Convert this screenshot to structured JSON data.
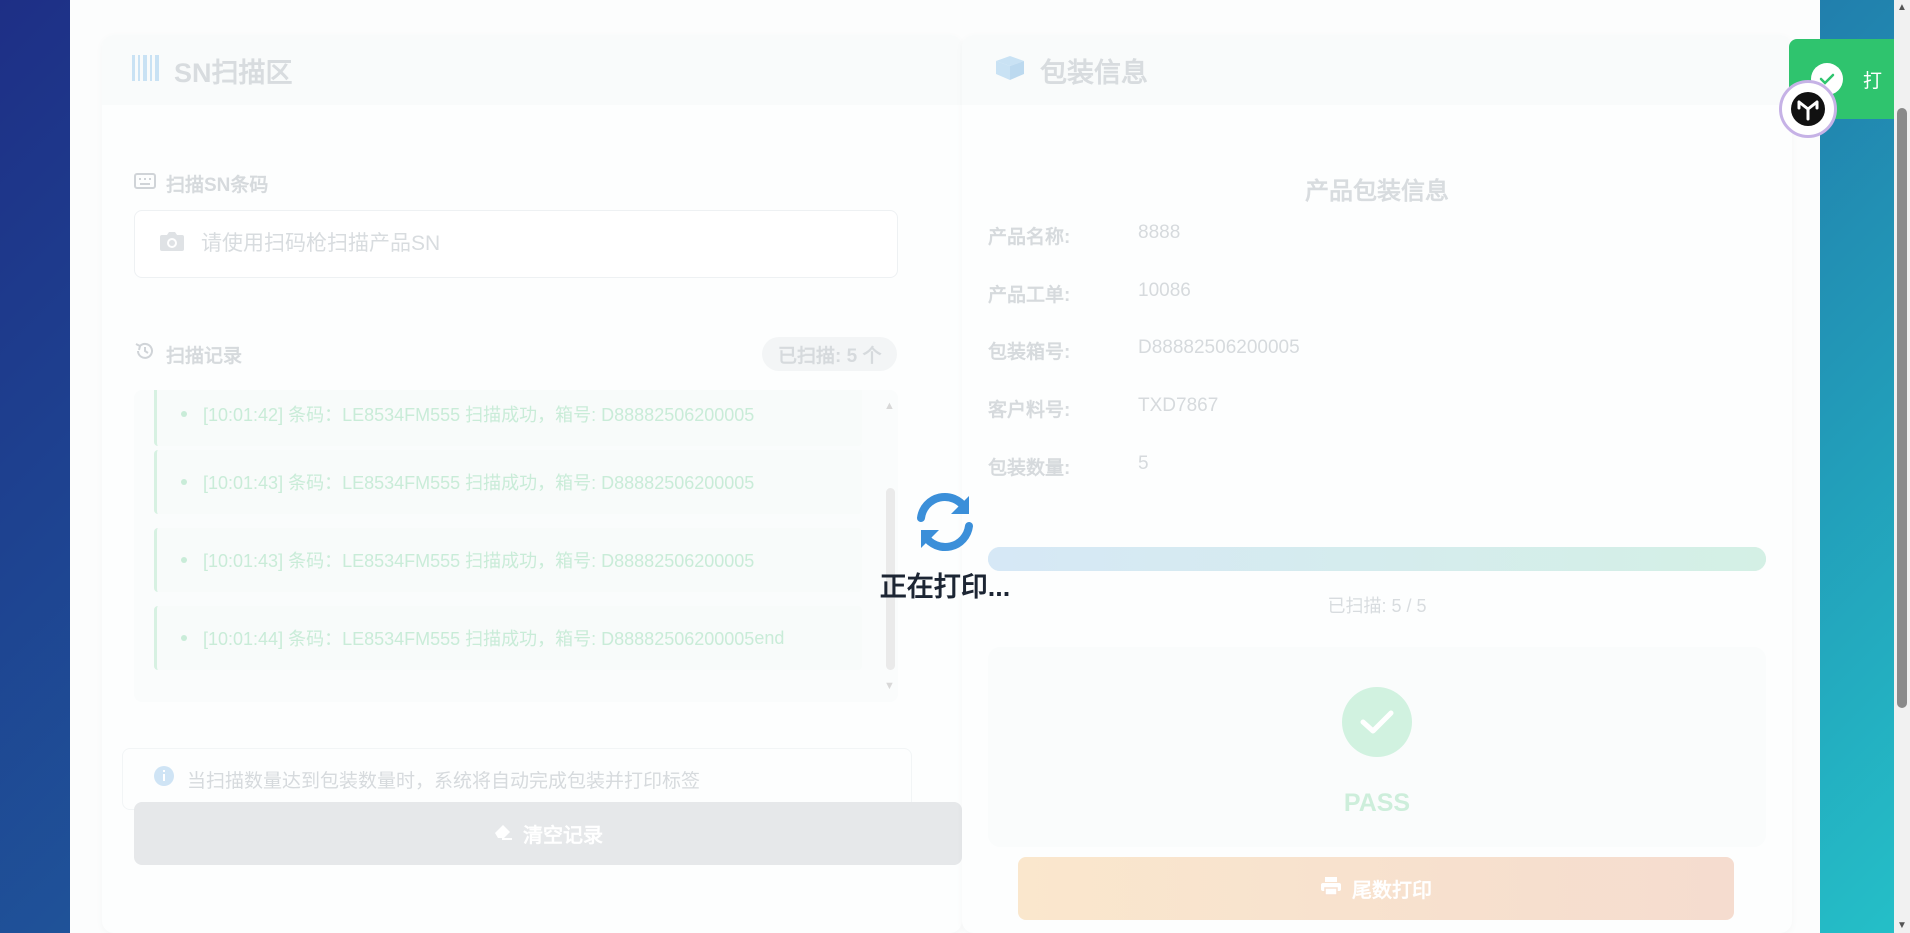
{
  "scan_panel": {
    "title": "SN扫描区",
    "scan_label": "扫描SN条码",
    "scan_placeholder": "请使用扫码枪扫描产品SN",
    "records_label": "扫描记录",
    "scanned_badge": "已扫描: 5 个",
    "records": [
      "[10:01:42] 条码：LE8534FM555 扫描成功，箱号: D88882506200005",
      "[10:01:43] 条码：LE8534FM555 扫描成功，箱号: D88882506200005",
      "[10:01:43] 条码：LE8534FM555 扫描成功，箱号: D88882506200005",
      "[10:01:44] 条码：LE8534FM555 扫描成功，箱号: D88882506200005"
    ],
    "tip": "当扫描数量达到包装数量时，系统将自动完成包装并打印标签",
    "clear_button": "清空记录"
  },
  "package_panel": {
    "title": "包装信息",
    "info_title": "产品包装信息",
    "fields": [
      {
        "key": "产品名称:",
        "value": "8888"
      },
      {
        "key": "产品工单:",
        "value": "10086"
      },
      {
        "key": "包装箱号:",
        "value": "D88882506200005"
      },
      {
        "key": "客户料号:",
        "value": "TXD7867"
      },
      {
        "key": "包装数量:",
        "value": "5"
      }
    ],
    "progress_fraction": 1.0,
    "progress_text": "已扫描: 5 / 5",
    "status": "PASS",
    "print_button": "尾数打印"
  },
  "overlay": {
    "loading_text": "正在打印..."
  },
  "toast": {
    "text": "打"
  },
  "colors": {
    "success": "#2fc46e",
    "loading_icon": "#3b8fd9",
    "text_dark": "#1c2533"
  }
}
